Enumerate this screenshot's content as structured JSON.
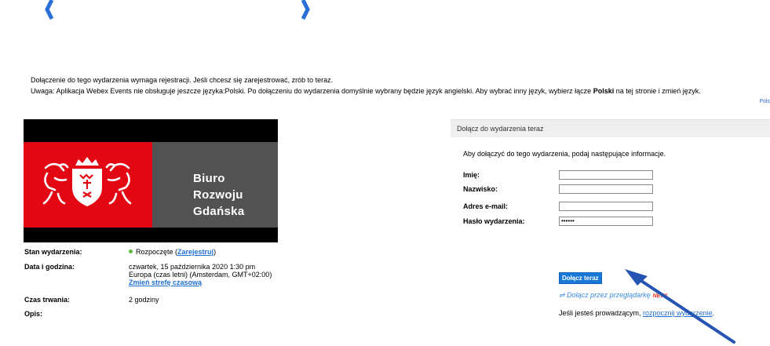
{
  "notice": {
    "line1": "Dołączenie do tego wydarzenia wymaga rejestracji. Jeśli chcesz się zarejestrować, zrób to teraz.",
    "line2_prefix": "Uwaga: Aplikacja Webex Events nie obsługuje jeszcze języka:Polski. Po dołączeniu do wydarzenia domyślnie wybrany będzie język angielski. Aby wybrać inny język, wybierz łącze ",
    "line2_bold": "Polski",
    "line2_suffix": " na tej stronie i zmień język.",
    "language_link": "Pols"
  },
  "banner": {
    "title_line1": "Biuro Rozwoju",
    "title_line2": "Gdańska"
  },
  "event": {
    "status_label": "Stan wydarzenia:",
    "status_value": "Rozpoczęte",
    "register_link": "Zarejestruj",
    "datetime_label": "Data i godzina:",
    "datetime_line1": "czwartek, 15 października 2020 1:30 pm",
    "datetime_line2": "Europa (czas letni) (Amsterdam, GMT+02:00)",
    "change_timezone": "Zmień strefę czasową",
    "duration_label": "Czas trwania:",
    "duration_value": "2 godziny",
    "description_label": "Opis:"
  },
  "join": {
    "header": "Dołącz do wydarzenia teraz",
    "intro": "Aby dołączyć do tego wydarzenia, podaj następujące informacje.",
    "first_name_label": "Imię:",
    "first_name_value": "",
    "last_name_label": "Nazwisko:",
    "last_name_value": "",
    "email_label": "Adres e-mail:",
    "email_value": "",
    "password_label": "Hasło wydarzenia:",
    "password_value": "••••••",
    "join_button": "Dołącz teraz",
    "browser_join": "Dołącz przez przeglądarkę",
    "new_badge": "NEW!",
    "host_prefix": "Jeśli jesteś prowadzącym, ",
    "host_link": "rozpocznij wydarzenie",
    "host_suffix": "."
  },
  "colors": {
    "banner_red": "#e30613",
    "banner_grey": "#525252",
    "accent_blue": "#1878d7",
    "annotation_arrow": "#2554b3",
    "bracket_blue": "#2a6fd6"
  }
}
